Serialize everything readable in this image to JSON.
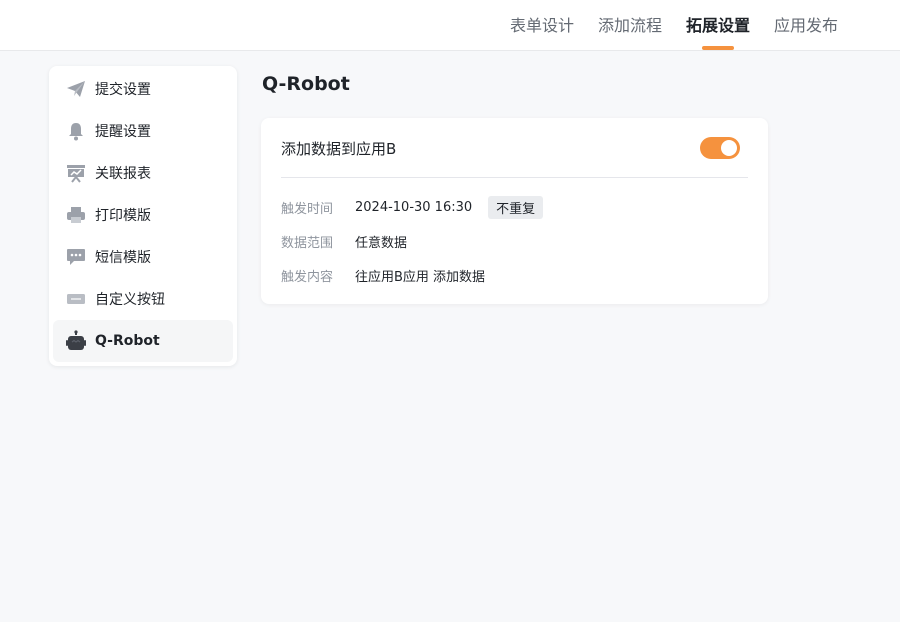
{
  "header": {
    "tabs": [
      {
        "label": "表单设计"
      },
      {
        "label": "添加流程"
      },
      {
        "label": "拓展设置",
        "active": true
      },
      {
        "label": "应用发布"
      }
    ],
    "accent_color": "#f5923e"
  },
  "sidebar": {
    "items": [
      {
        "label": "提交设置",
        "icon": "send-icon"
      },
      {
        "label": "提醒设置",
        "icon": "bell-icon"
      },
      {
        "label": "关联报表",
        "icon": "report-icon"
      },
      {
        "label": "打印模版",
        "icon": "printer-icon"
      },
      {
        "label": "短信模版",
        "icon": "message-icon"
      },
      {
        "label": "自定义按钮",
        "icon": "button-icon"
      },
      {
        "label": "Q-Robot",
        "icon": "robot-icon",
        "active": true
      }
    ]
  },
  "main": {
    "title": "Q-Robot",
    "card": {
      "title": "添加数据到应用B",
      "enabled": true,
      "rows": [
        {
          "label": "触发时间",
          "value": "2024-10-30 16:30",
          "badge": "不重复"
        },
        {
          "label": "数据范围",
          "value": "任意数据"
        },
        {
          "label": "触发内容",
          "value": "往应用B应用 添加数据"
        }
      ]
    }
  }
}
